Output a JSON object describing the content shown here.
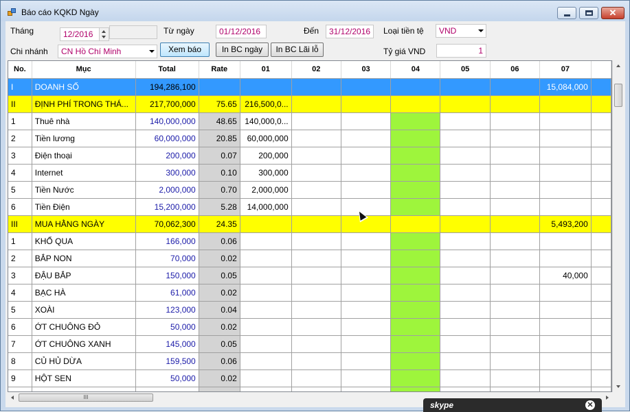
{
  "window": {
    "title": "Báo cáo KQKD Ngày"
  },
  "form": {
    "thang_label": "Tháng",
    "thang_value": "12/2016",
    "tu_ngay_label": "Từ ngày",
    "tu_ngay_value": "01/12/2016",
    "den_label": "Đến",
    "den_value": "31/12/2016",
    "loai_tien_label": "Loại tiền tệ",
    "loai_tien_value": "VND",
    "chi_nhanh_label": "Chi nhánh",
    "chi_nhanh_value": "CN Hồ Chí Minh",
    "ty_gia_label": "Tỷ giá VND",
    "ty_gia_value": "1",
    "xem_bao_label": "Xem báo",
    "in_bc_ngay_label": "In BC ngày",
    "in_bc_lai_lo_label": "In BC Lãi lỗ"
  },
  "grid": {
    "columns": [
      "No.",
      "Mục",
      "Total",
      "Rate",
      "01",
      "02",
      "03",
      "04",
      "05",
      "06",
      "07"
    ],
    "rows": [
      {
        "style": "blue",
        "cells": [
          "I",
          "DOANH SỐ",
          "194,286,100",
          "",
          "",
          "",
          "",
          "",
          "",
          "",
          "15,084,000"
        ]
      },
      {
        "style": "yellow",
        "cells": [
          "II",
          "ĐỊNH PHÍ TRONG THÁ...",
          "217,700,000",
          "75.65",
          "216,500,0...",
          "",
          "",
          "",
          "",
          "",
          ""
        ]
      },
      {
        "style": "",
        "cells": [
          "1",
          "Thuê nhà",
          "140,000,000",
          "48.65",
          "140,000,0...",
          "",
          "",
          "",
          "",
          "",
          ""
        ]
      },
      {
        "style": "",
        "cells": [
          "2",
          "Tiền lương",
          "60,000,000",
          "20.85",
          "60,000,000",
          "",
          "",
          "",
          "",
          "",
          ""
        ]
      },
      {
        "style": "",
        "cells": [
          "3",
          "Điện thoại",
          "200,000",
          "0.07",
          "200,000",
          "",
          "",
          "",
          "",
          "",
          ""
        ]
      },
      {
        "style": "",
        "cells": [
          "4",
          "Internet",
          "300,000",
          "0.10",
          "300,000",
          "",
          "",
          "",
          "",
          "",
          ""
        ]
      },
      {
        "style": "",
        "cells": [
          "5",
          "Tiền Nước",
          "2,000,000",
          "0.70",
          "2,000,000",
          "",
          "",
          "",
          "",
          "",
          ""
        ]
      },
      {
        "style": "",
        "cells": [
          "6",
          "Tiền Điện",
          "15,200,000",
          "5.28",
          "14,000,000",
          "",
          "",
          "",
          "",
          "",
          ""
        ]
      },
      {
        "style": "yellow",
        "cells": [
          "III",
          "MUA HẰNG NGÀY",
          "70,062,300",
          "24.35",
          "",
          "",
          "",
          "",
          "",
          "",
          "5,493,200"
        ]
      },
      {
        "style": "",
        "cells": [
          "1",
          "KHỔ QUA",
          "166,000",
          "0.06",
          "",
          "",
          "",
          "",
          "",
          "",
          ""
        ]
      },
      {
        "style": "",
        "cells": [
          "2",
          "BẮP NON",
          "70,000",
          "0.02",
          "",
          "",
          "",
          "",
          "",
          "",
          ""
        ]
      },
      {
        "style": "",
        "cells": [
          "3",
          "ĐẬU BẮP",
          "150,000",
          "0.05",
          "",
          "",
          "",
          "",
          "",
          "",
          "40,000"
        ]
      },
      {
        "style": "",
        "cells": [
          "4",
          "BẠC HÀ",
          "61,000",
          "0.02",
          "",
          "",
          "",
          "",
          "",
          "",
          ""
        ]
      },
      {
        "style": "",
        "cells": [
          "5",
          "XOÀI",
          "123,000",
          "0.04",
          "",
          "",
          "",
          "",
          "",
          "",
          ""
        ]
      },
      {
        "style": "",
        "cells": [
          "6",
          "ỚT CHUÔNG ĐỎ",
          "50,000",
          "0.02",
          "",
          "",
          "",
          "",
          "",
          "",
          ""
        ]
      },
      {
        "style": "",
        "cells": [
          "7",
          "ỚT CHUÔNG XANH",
          "145,000",
          "0.05",
          "",
          "",
          "",
          "",
          "",
          "",
          ""
        ]
      },
      {
        "style": "",
        "cells": [
          "8",
          "CỦ HỦ DỪA",
          "159,500",
          "0.06",
          "",
          "",
          "",
          "",
          "",
          "",
          ""
        ]
      },
      {
        "style": "",
        "cells": [
          "9",
          "HỘT SEN",
          "50,000",
          "0.02",
          "",
          "",
          "",
          "",
          "",
          "",
          ""
        ]
      },
      {
        "style": "",
        "cells": [
          "",
          "",
          "",
          "",
          "",
          "",
          "",
          "",
          "",
          "",
          ""
        ]
      }
    ]
  },
  "scrollbar": {
    "h_thumb_grip": "III"
  },
  "skype": {
    "logo_text": "skype",
    "close_glyph": "✕"
  },
  "colors": {
    "header_row_blue": "#3399ff",
    "group_row_yellow": "#ffff00",
    "column_04_green": "#9ef53c",
    "rate_gray": "#d4d4d4",
    "total_text": "#1a1aa8",
    "input_text": "#b0006a"
  }
}
